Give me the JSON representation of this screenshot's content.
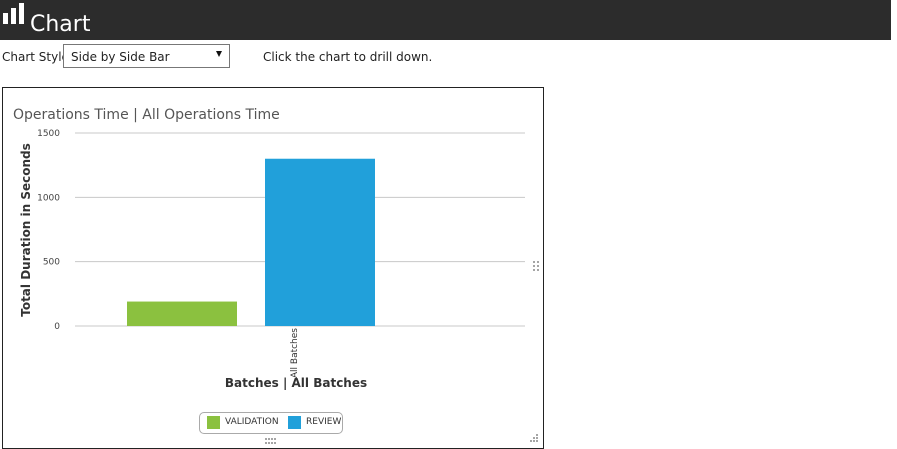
{
  "app": {
    "title": "Chart",
    "logo_icon": "bar-chart-icon"
  },
  "controls": {
    "chart_style_label": "Chart Style:",
    "chart_style_value": "Side by Side Bar",
    "hint": "Click the chart to drill down."
  },
  "colors": {
    "header_bg": "#2c2c2c",
    "validation": "#8bc13f",
    "review": "#21a0da"
  },
  "chart_data": {
    "type": "bar",
    "title": "Operations Time | All Operations Time",
    "xlabel": "Batches | All Batches",
    "ylabel": "Total Duration in Seconds",
    "categories": [
      "All Batches"
    ],
    "series": [
      {
        "name": "VALIDATION",
        "values": [
          190
        ]
      },
      {
        "name": "REVIEW",
        "values": [
          1300
        ]
      }
    ],
    "ylim": [
      0,
      1500
    ],
    "yticks": [
      "0",
      "500",
      "1000",
      "1500"
    ],
    "grid": true,
    "legend_position": "bottom"
  }
}
